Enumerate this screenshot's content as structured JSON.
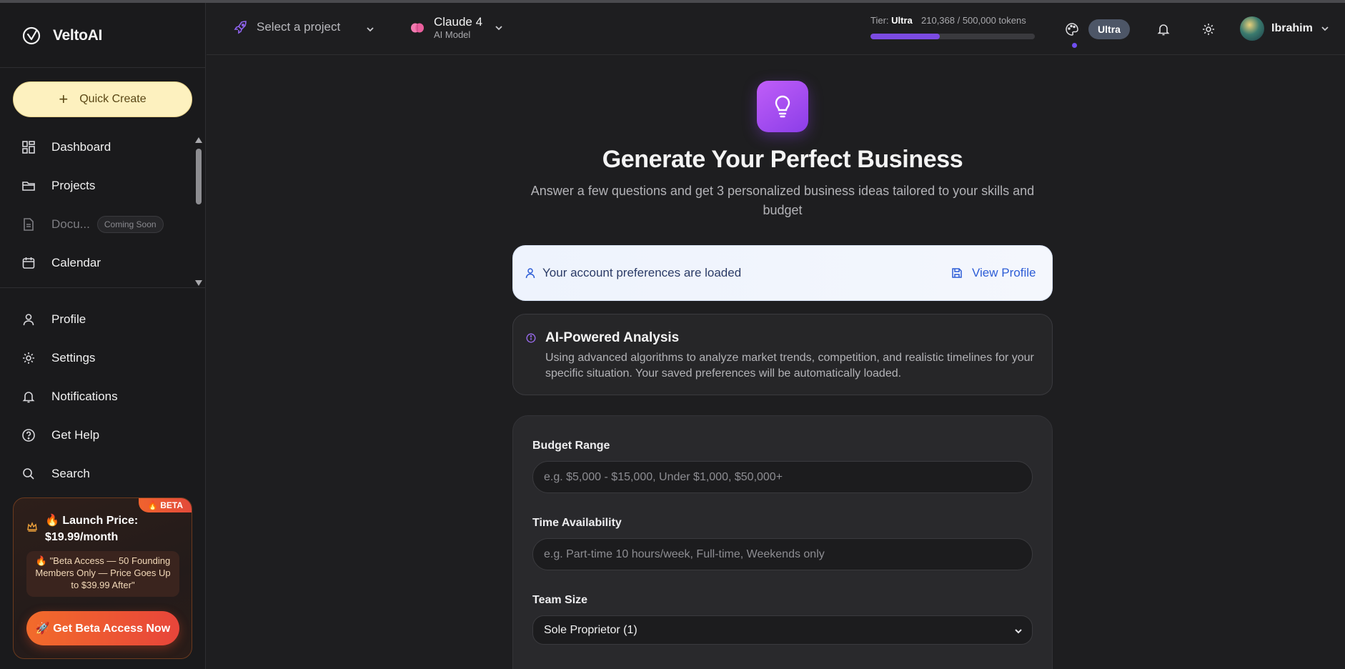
{
  "app": {
    "name": "VeltoAI"
  },
  "sidebar": {
    "quick_create": "Quick Create",
    "primary": [
      {
        "label": "Dashboard",
        "icon": "dashboard-icon"
      },
      {
        "label": "Projects",
        "icon": "folder-icon"
      },
      {
        "label": "Docu...",
        "icon": "document-icon",
        "badge": "Coming Soon",
        "disabled": true
      },
      {
        "label": "Calendar",
        "icon": "calendar-icon"
      }
    ],
    "secondary": [
      {
        "label": "Profile",
        "icon": "user-icon"
      },
      {
        "label": "Settings",
        "icon": "gear-icon"
      },
      {
        "label": "Notifications",
        "icon": "bell-icon"
      },
      {
        "label": "Get Help",
        "icon": "help-circle-icon"
      },
      {
        "label": "Search",
        "icon": "search-icon"
      }
    ],
    "promo": {
      "ribbon": "🔥 BETA",
      "title": "🔥 Launch Price: $19.99/month",
      "note": "🔥 \"Beta Access — 50 Founding Members Only — Price Goes Up to $39.99 After\"",
      "cta": "🚀 Get Beta Access Now"
    }
  },
  "topbar": {
    "project_placeholder": "Select a project",
    "model": {
      "name": "Claude 4",
      "sub": "AI Model"
    },
    "tier_label": "Tier:",
    "tier_value": "Ultra",
    "tokens": "210,368 / 500,000 tokens",
    "token_usage_fraction": 0.421,
    "badge": "Ultra",
    "user_name": "Ibrahim"
  },
  "main": {
    "title": "Generate Your Perfect Business",
    "subtitle": "Answer a few questions and get 3 personalized business ideas tailored to your skills and budget",
    "preferences": {
      "text": "Your account preferences are loaded",
      "link": "View Profile"
    },
    "analysis": {
      "title": "AI-Powered Analysis",
      "text": "Using advanced algorithms to analyze market trends, competition, and realistic timelines for your specific situation. Your saved preferences will be automatically loaded."
    },
    "form": {
      "budget": {
        "label": "Budget Range",
        "placeholder": "e.g. $5,000 - $15,000, Under $1,000, $50,000+"
      },
      "time": {
        "label": "Time Availability",
        "placeholder": "e.g. Part-time 10 hours/week, Full-time, Weekends only"
      },
      "team": {
        "label": "Team Size",
        "value": "Sole Proprietor (1)"
      }
    }
  },
  "colors": {
    "accent": "#7b4be2",
    "hero_gradient": [
      "#c05ef8",
      "#8b3ee8"
    ],
    "quick_create_bg": "#fdf1bf",
    "promo_cta": "#f26b2b",
    "link": "#2d5dd6"
  }
}
